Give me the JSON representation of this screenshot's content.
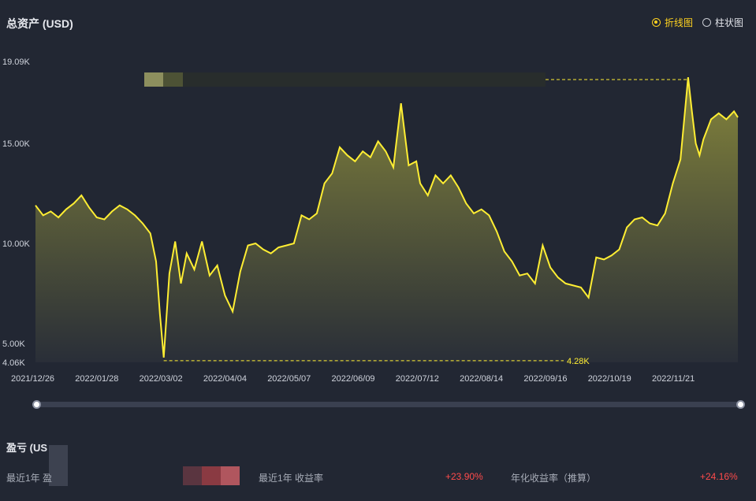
{
  "header": {
    "title": "总资产 (USD)"
  },
  "toggle": {
    "line_label": "折线图",
    "bar_label": "柱状图"
  },
  "chart_data": {
    "type": "area",
    "title": "总资产 (USD)",
    "y_ticks": [
      "4.06K",
      "5.00K",
      "10.00K",
      "15.00K",
      "19.09K"
    ],
    "y_tick_values": [
      4060,
      5000,
      10000,
      15000,
      19090
    ],
    "ylim": [
      4060,
      19090
    ],
    "x_tick_labels": [
      "2021/12/26",
      "2022/01/28",
      "2022/03/02",
      "2022/04/04",
      "2022/05/07",
      "2022/06/09",
      "2022/07/12",
      "2022/08/14",
      "2022/09/16",
      "2022/10/19",
      "2022/11/21"
    ],
    "x_range": [
      "2021/12/26",
      "2022/12/28"
    ],
    "min_label": "4.28K",
    "min_value": 4280,
    "max_value": 19090,
    "colors": {
      "line": "#ffee33",
      "fill_top": "#8a8a3c",
      "fill_bottom": "#2a2f38"
    },
    "series": [
      {
        "x": [
          "2021/12/26",
          "2021/12/30",
          "2022/01/03",
          "2022/01/07",
          "2022/01/11",
          "2022/01/15",
          "2022/01/19",
          "2022/01/23",
          "2022/01/27",
          "2022/01/31",
          "2022/02/04",
          "2022/02/08",
          "2022/02/12",
          "2022/02/16",
          "2022/02/20",
          "2022/02/24",
          "2022/02/27",
          "2022/03/01",
          "2022/03/03",
          "2022/03/06",
          "2022/03/09",
          "2022/03/12",
          "2022/03/15",
          "2022/03/19",
          "2022/03/23",
          "2022/03/27",
          "2022/03/31",
          "2022/04/04",
          "2022/04/08",
          "2022/04/12",
          "2022/04/16",
          "2022/04/20",
          "2022/04/24",
          "2022/04/28",
          "2022/05/02",
          "2022/05/06",
          "2022/05/10",
          "2022/05/14",
          "2022/05/18",
          "2022/05/22",
          "2022/05/26",
          "2022/05/30",
          "2022/06/03",
          "2022/06/07",
          "2022/06/11",
          "2022/06/15",
          "2022/06/19",
          "2022/06/23",
          "2022/06/27",
          "2022/07/01",
          "2022/07/05",
          "2022/07/09",
          "2022/07/13",
          "2022/07/15",
          "2022/07/19",
          "2022/07/23",
          "2022/07/27",
          "2022/07/31",
          "2022/08/04",
          "2022/08/08",
          "2022/08/12",
          "2022/08/16",
          "2022/08/20",
          "2022/08/24",
          "2022/08/28",
          "2022/09/01",
          "2022/09/05",
          "2022/09/09",
          "2022/09/13",
          "2022/09/17",
          "2022/09/21",
          "2022/09/25",
          "2022/09/29",
          "2022/10/03",
          "2022/10/07",
          "2022/10/11",
          "2022/10/15",
          "2022/10/19",
          "2022/10/23",
          "2022/10/27",
          "2022/10/31",
          "2022/11/04",
          "2022/11/08",
          "2022/11/12",
          "2022/11/16",
          "2022/11/20",
          "2022/11/24",
          "2022/11/28",
          "2022/12/02",
          "2022/12/04",
          "2022/12/06",
          "2022/12/08",
          "2022/12/10",
          "2022/12/14",
          "2022/12/18",
          "2022/12/22",
          "2022/12/26",
          "2022/12/28"
        ],
        "y": [
          11900,
          11400,
          11600,
          11300,
          11700,
          12000,
          12400,
          11800,
          11300,
          11200,
          11600,
          11900,
          11700,
          11400,
          11000,
          10500,
          9100,
          6500,
          4300,
          8500,
          10100,
          8000,
          9500,
          8700,
          10100,
          8400,
          8900,
          7400,
          6600,
          8600,
          9900,
          10000,
          9700,
          9500,
          9800,
          9900,
          10000,
          11400,
          11200,
          11500,
          13000,
          13500,
          14800,
          14400,
          14100,
          14600,
          14300,
          15100,
          14600,
          13800,
          17000,
          13900,
          14100,
          13000,
          12400,
          13400,
          13000,
          13400,
          12800,
          12000,
          11500,
          11700,
          11400,
          10600,
          9600,
          9100,
          8400,
          8500,
          8000,
          9900,
          8800,
          8300,
          8000,
          7900,
          7800,
          7300,
          9300,
          9200,
          9400,
          9700,
          10800,
          11200,
          11300,
          11000,
          10900,
          11500,
          13000,
          14200,
          18300,
          16600,
          15000,
          14400,
          15200,
          16200,
          16500,
          16200,
          16600,
          16300
        ]
      }
    ]
  },
  "bottom": {
    "title": "盈亏 (US",
    "stat1_label": "最近1年  盈",
    "stat2_label": "最近1年  收益率",
    "stat2_value": "+23.90%",
    "stat3_label": "年化收益率（推算）",
    "stat3_value": "+24.16%"
  }
}
